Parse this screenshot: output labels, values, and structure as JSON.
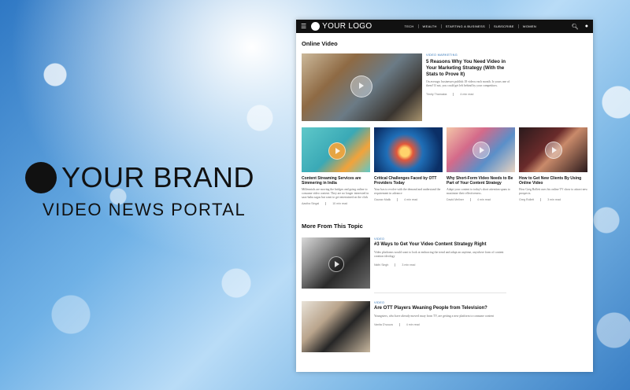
{
  "brand": {
    "title": "YOUR BRAND",
    "subtitle": "VIDEO NEWS PORTAL"
  },
  "site": {
    "logo": "YOUR LOGO",
    "nav_links": [
      "TECH",
      "WEALTH",
      "STARTING A BUSINESS",
      "SUBSCRIBE",
      "WOMEN"
    ],
    "section1": "Online Video",
    "featured": {
      "category": "VIDEO MARKETING",
      "title": "5 Reasons Why You Need Video in Your Marketing Strategy (With the Stats to Prove It)",
      "excerpt": "On average, businesses publish 18 videos each month. Is yours one of them? If not, you could get left behind by your competitors.",
      "author": "Trinity Thamakia",
      "read": "4 min read"
    },
    "cards": [
      {
        "title": "Content Streaming Services are Simmering in India",
        "excerpt": "Millennials are moving the bridges and going online to consume video content. They are no longer interested in saas-bahu sagas but want to get entertained on the click",
        "author": "Aastha Singal",
        "read": "10 min read"
      },
      {
        "title": "Critical Challenges Faced by OTT Providers Today",
        "excerpt": "Your has to evolve with the demand and understand the requirement in advance",
        "author": "Gaurav Malik",
        "read": "4 min read"
      },
      {
        "title": "Why Short-Form Video Needs to Be Part of Your Content Strategy",
        "excerpt": "Adapt your content to today's short attention spans to maximize their effectiveness.",
        "author": "David Mellner",
        "read": "4 min read"
      },
      {
        "title": "How to Get New Clients By Using Online Video",
        "excerpt": "How Greg Rollett uses his online TV show to attract new prospects.",
        "author": "Greg Rollett",
        "read": "3 min read"
      }
    ],
    "section2": "More From This Topic",
    "list": [
      {
        "category": "VIDEO",
        "title": "#3 Ways to Get Your Video Content Strategy Right",
        "excerpt": "Video platforms would want to look at embracing the trend and adapt an anytime, anywhere form of content creation ideology",
        "author": "Nidhi Singh",
        "read": "3 min read"
      },
      {
        "category": "VIDEO",
        "title": "Are OTT Players Weaning People from Television?",
        "excerpt": "Youngsters, who have already moved away from TV, are getting a new platform to consume content",
        "author": "Vanita D'souza",
        "read": "4 min read"
      }
    ]
  }
}
